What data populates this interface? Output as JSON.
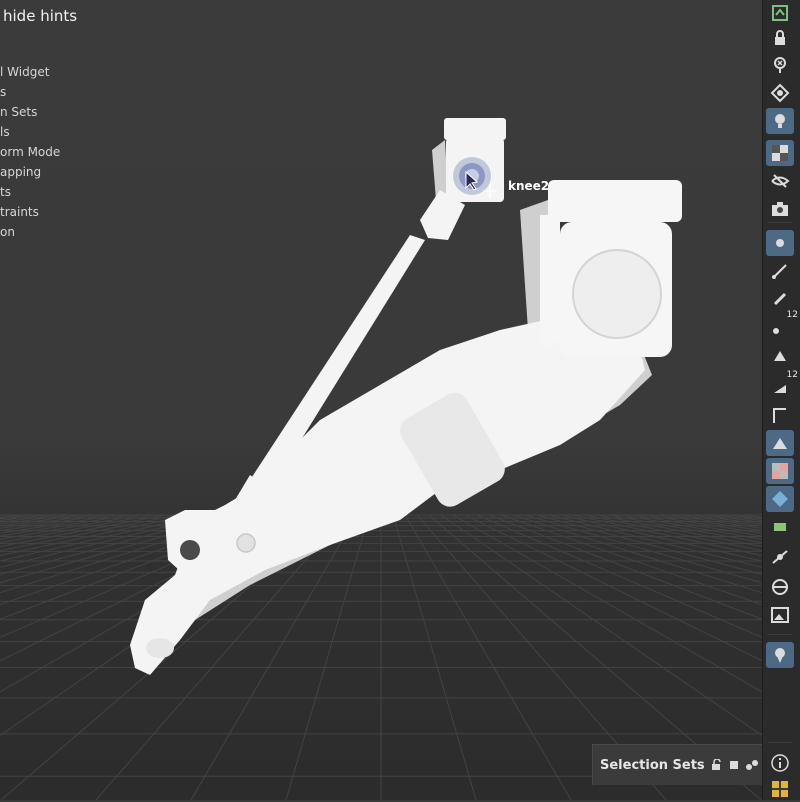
{
  "viewport": {
    "hints_title": "hide hints",
    "hints": [
      "l Widget",
      "s",
      "n Sets",
      "ls",
      "orm Mode",
      "apping",
      "ts",
      "traints",
      "on"
    ],
    "knee_label": "knee2"
  },
  "toolbar": {
    "tools": [
      "view-icon",
      "lock-icon",
      "pin-icon",
      "diamond-eye-icon",
      "lightbulb-icon",
      "checker-icon",
      "eye-slash-icon",
      "camera-icon",
      "point-icon",
      "edge-icon",
      "brush-icon",
      "vertex-icon",
      "flag-icon",
      "flag-numbered-icon",
      "curve-icon",
      "surface-icon",
      "texture-icon",
      "transform-icon",
      "bone-icon",
      "joint-icon",
      "sphere-icon",
      "image-icon",
      "location-icon"
    ],
    "badges": {
      "vertex": "12",
      "flag": "12"
    }
  },
  "selection_panel": {
    "title": "Selection Sets"
  },
  "bottom_tools": [
    "info-icon",
    "grid-icon"
  ],
  "colors": {
    "viewport_bg": "#3a3a3a",
    "toolbar_bg": "#2b2b2b",
    "active_tool": "#4c6a86",
    "model": "#f4f4f4"
  }
}
